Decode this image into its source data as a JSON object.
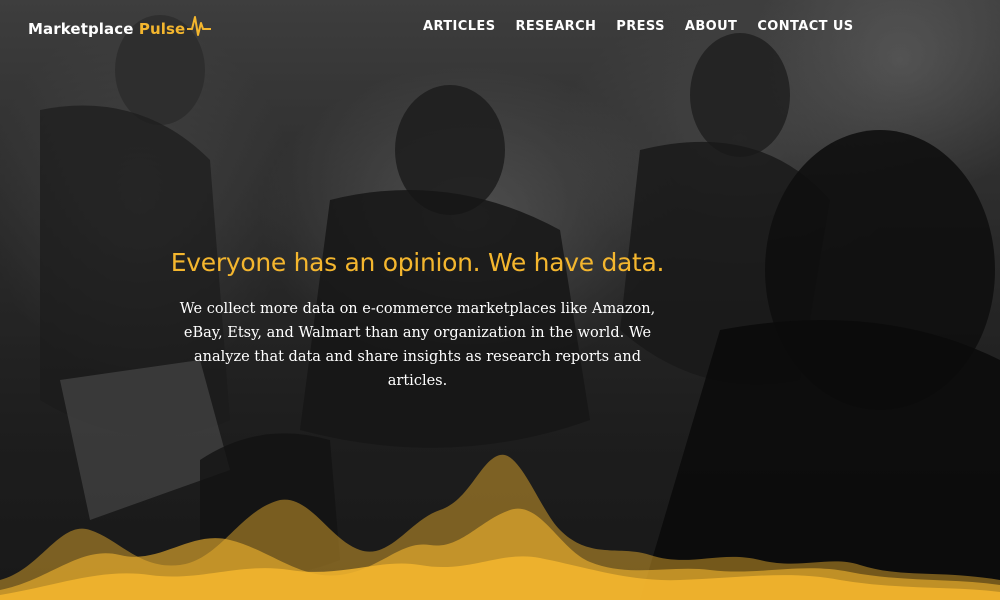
{
  "brand": {
    "name_part1": "Marketplace ",
    "name_part2": "Pulse",
    "accent_color": "#f4b62e",
    "logo_icon": "pulse-line-icon"
  },
  "nav": {
    "items": [
      "ARTICLES",
      "RESEARCH",
      "PRESS",
      "ABOUT",
      "CONTACT US"
    ]
  },
  "hero": {
    "headline": "Everyone has an opinion. We have data.",
    "description": "We collect more data on e-commerce marketplaces like Amazon, eBay, Etsy, and Walmart than any organization in the world. We analyze that data and share insights as research reports and articles.",
    "background": "black-and-white photo of sprinters starting a race",
    "wave_color": "#f4b62e"
  }
}
